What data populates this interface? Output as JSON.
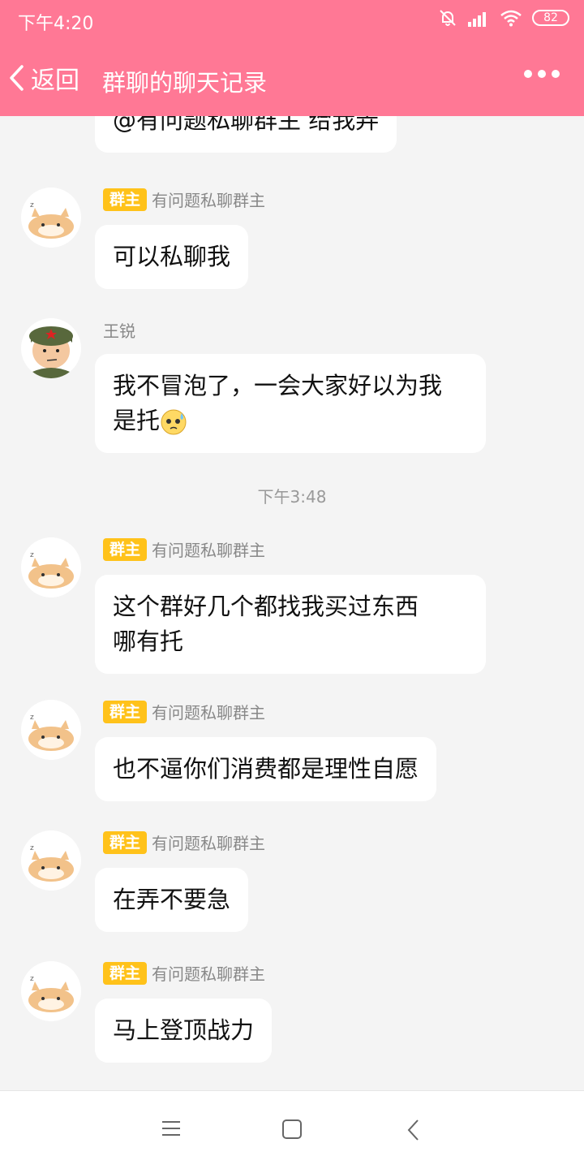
{
  "status_bar": {
    "time": "下午4:20",
    "battery": "82"
  },
  "nav": {
    "back_label": "返回",
    "title": "群聊的聊天记录"
  },
  "badge_label": "群主",
  "top_partial": {
    "text": "@有问题私聊群主  给我弄"
  },
  "messages": [
    {
      "sender": "有问题私聊群主",
      "text": "可以私聊我"
    },
    {
      "sender": "王锐",
      "line1": "我不冒泡了，一会大家好以为我",
      "line2": "是托"
    },
    {
      "sender": "有问题私聊群主",
      "line1": "这个群好几个都找我买过东西",
      "line2": "哪有托"
    },
    {
      "sender": "有问题私聊群主",
      "text": "也不逼你们消费都是理性自愿"
    },
    {
      "sender": "有问题私聊群主",
      "text": "在弄不要急"
    },
    {
      "sender": "有问题私聊群主",
      "text": "马上登顶战力"
    }
  ],
  "timestamp": "下午3:48",
  "colors": {
    "header": "#ff7895",
    "badge": "#ffc21a",
    "background": "#f4f4f4"
  }
}
